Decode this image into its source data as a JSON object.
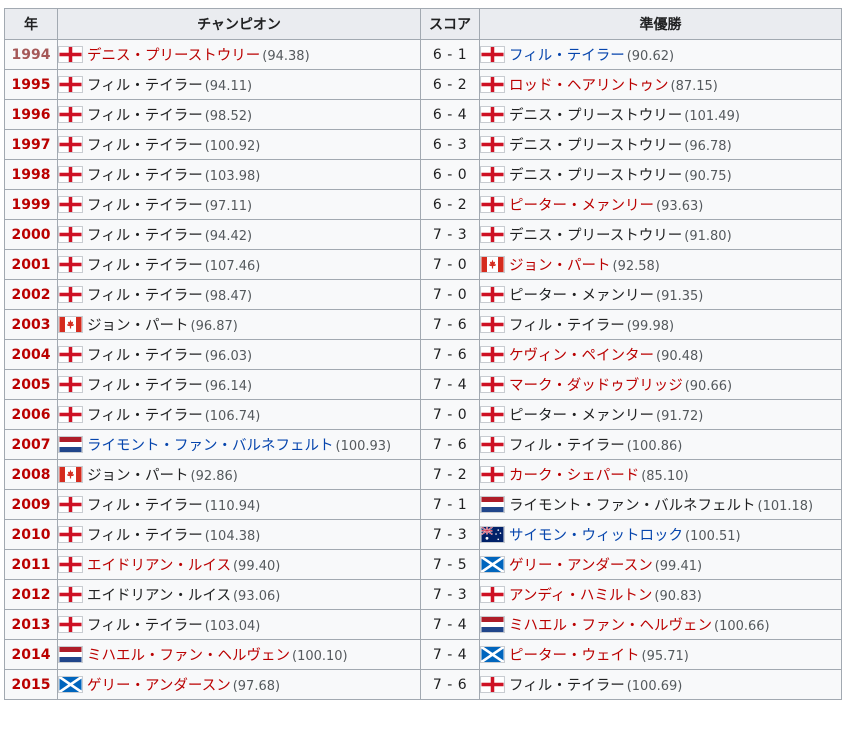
{
  "headers": {
    "year": "年",
    "champion": "チャンピオン",
    "score": "スコア",
    "runner_up": "準優勝"
  },
  "colors": {
    "link": "#0645ad",
    "redlink": "#ba0000",
    "header_bg": "#eaecf0",
    "border": "#a2a9b1"
  },
  "rows": [
    {
      "year": "1994",
      "year_style": "visited",
      "champion": {
        "flag": "england",
        "name": "デニス・プリーストウリー",
        "style": "redlink",
        "avg": "(94.38)"
      },
      "score": "6 - 1",
      "runner_up": {
        "flag": "england",
        "name": "フィル・テイラー",
        "style": "link",
        "avg": "(90.62)"
      }
    },
    {
      "year": "1995",
      "year_style": "redlink",
      "champion": {
        "flag": "england",
        "name": "フィル・テイラー",
        "style": "plain",
        "avg": "(94.11)"
      },
      "score": "6 - 2",
      "runner_up": {
        "flag": "england",
        "name": "ロッド・ヘアリントゥン",
        "style": "redlink",
        "avg": "(87.15)"
      }
    },
    {
      "year": "1996",
      "year_style": "redlink",
      "champion": {
        "flag": "england",
        "name": "フィル・テイラー",
        "style": "plain",
        "avg": "(98.52)"
      },
      "score": "6 - 4",
      "runner_up": {
        "flag": "england",
        "name": "デニス・プリーストウリー",
        "style": "plain",
        "avg": "(101.49)"
      }
    },
    {
      "year": "1997",
      "year_style": "redlink",
      "champion": {
        "flag": "england",
        "name": "フィル・テイラー",
        "style": "plain",
        "avg": "(100.92)"
      },
      "score": "6 - 3",
      "runner_up": {
        "flag": "england",
        "name": "デニス・プリーストウリー",
        "style": "plain",
        "avg": "(96.78)"
      }
    },
    {
      "year": "1998",
      "year_style": "redlink",
      "champion": {
        "flag": "england",
        "name": "フィル・テイラー",
        "style": "plain",
        "avg": "(103.98)"
      },
      "score": "6 - 0",
      "runner_up": {
        "flag": "england",
        "name": "デニス・プリーストウリー",
        "style": "plain",
        "avg": "(90.75)"
      }
    },
    {
      "year": "1999",
      "year_style": "redlink",
      "champion": {
        "flag": "england",
        "name": "フィル・テイラー",
        "style": "plain",
        "avg": "(97.11)"
      },
      "score": "6 - 2",
      "runner_up": {
        "flag": "england",
        "name": "ピーター・メァンリー",
        "style": "redlink",
        "avg": "(93.63)"
      }
    },
    {
      "year": "2000",
      "year_style": "redlink",
      "champion": {
        "flag": "england",
        "name": "フィル・テイラー",
        "style": "plain",
        "avg": "(94.42)"
      },
      "score": "7 - 3",
      "runner_up": {
        "flag": "england",
        "name": "デニス・プリーストウリー",
        "style": "plain",
        "avg": "(91.80)"
      }
    },
    {
      "year": "2001",
      "year_style": "redlink",
      "champion": {
        "flag": "england",
        "name": "フィル・テイラー",
        "style": "plain",
        "avg": "(107.46)"
      },
      "score": "7 - 0",
      "runner_up": {
        "flag": "canada",
        "name": "ジョン・パート",
        "style": "redlink",
        "avg": "(92.58)"
      }
    },
    {
      "year": "2002",
      "year_style": "redlink",
      "champion": {
        "flag": "england",
        "name": "フィル・テイラー",
        "style": "plain",
        "avg": "(98.47)"
      },
      "score": "7 - 0",
      "runner_up": {
        "flag": "england",
        "name": "ピーター・メァンリー",
        "style": "plain",
        "avg": "(91.35)"
      }
    },
    {
      "year": "2003",
      "year_style": "redlink",
      "champion": {
        "flag": "canada",
        "name": "ジョン・パート",
        "style": "plain",
        "avg": "(96.87)"
      },
      "score": "7 - 6",
      "runner_up": {
        "flag": "england",
        "name": "フィル・テイラー",
        "style": "plain",
        "avg": "(99.98)"
      }
    },
    {
      "year": "2004",
      "year_style": "redlink",
      "champion": {
        "flag": "england",
        "name": "フィル・テイラー",
        "style": "plain",
        "avg": "(96.03)"
      },
      "score": "7 - 6",
      "runner_up": {
        "flag": "england",
        "name": "ケヴィン・ペインター",
        "style": "redlink",
        "avg": "(90.48)"
      }
    },
    {
      "year": "2005",
      "year_style": "redlink",
      "champion": {
        "flag": "england",
        "name": "フィル・テイラー",
        "style": "plain",
        "avg": "(96.14)"
      },
      "score": "7 - 4",
      "runner_up": {
        "flag": "england",
        "name": "マーク・ダッドゥブリッジ",
        "style": "redlink",
        "avg": "(90.66)"
      }
    },
    {
      "year": "2006",
      "year_style": "redlink",
      "champion": {
        "flag": "england",
        "name": "フィル・テイラー",
        "style": "plain",
        "avg": "(106.74)"
      },
      "score": "7 - 0",
      "runner_up": {
        "flag": "england",
        "name": "ピーター・メァンリー",
        "style": "plain",
        "avg": "(91.72)"
      }
    },
    {
      "year": "2007",
      "year_style": "redlink",
      "champion": {
        "flag": "netherlands",
        "name": "ライモント・ファン・バルネフェルト",
        "style": "link",
        "avg": "(100.93)"
      },
      "score": "7 - 6",
      "runner_up": {
        "flag": "england",
        "name": "フィル・テイラー",
        "style": "plain",
        "avg": "(100.86)"
      }
    },
    {
      "year": "2008",
      "year_style": "redlink",
      "champion": {
        "flag": "canada",
        "name": "ジョン・パート",
        "style": "plain",
        "avg": "(92.86)"
      },
      "score": "7 - 2",
      "runner_up": {
        "flag": "england",
        "name": "カーク・シェパード",
        "style": "redlink",
        "avg": "(85.10)"
      }
    },
    {
      "year": "2009",
      "year_style": "redlink",
      "champion": {
        "flag": "england",
        "name": "フィル・テイラー",
        "style": "plain",
        "avg": "(110.94)"
      },
      "score": "7 - 1",
      "runner_up": {
        "flag": "netherlands",
        "name": "ライモント・ファン・バルネフェルト",
        "style": "plain",
        "avg": "(101.18)"
      }
    },
    {
      "year": "2010",
      "year_style": "redlink",
      "champion": {
        "flag": "england",
        "name": "フィル・テイラー",
        "style": "plain",
        "avg": "(104.38)"
      },
      "score": "7 - 3",
      "runner_up": {
        "flag": "australia",
        "name": "サイモン・ウィットロック",
        "style": "link",
        "avg": "(100.51)"
      }
    },
    {
      "year": "2011",
      "year_style": "redlink",
      "champion": {
        "flag": "england",
        "name": "エイドリアン・ルイス",
        "style": "redlink",
        "avg": "(99.40)"
      },
      "score": "7 - 5",
      "runner_up": {
        "flag": "scotland",
        "name": "ゲリー・アンダースン",
        "style": "redlink",
        "avg": "(99.41)"
      }
    },
    {
      "year": "2012",
      "year_style": "redlink",
      "champion": {
        "flag": "england",
        "name": "エイドリアン・ルイス",
        "style": "plain",
        "avg": "(93.06)"
      },
      "score": "7 - 3",
      "runner_up": {
        "flag": "england",
        "name": "アンディ・ハミルトン",
        "style": "redlink",
        "avg": "(90.83)"
      }
    },
    {
      "year": "2013",
      "year_style": "redlink",
      "champion": {
        "flag": "england",
        "name": "フィル・テイラー",
        "style": "plain",
        "avg": "(103.04)"
      },
      "score": "7 - 4",
      "runner_up": {
        "flag": "netherlands",
        "name": "ミハエル・ファン・ヘルヴェン",
        "style": "redlink",
        "avg": "(100.66)"
      }
    },
    {
      "year": "2014",
      "year_style": "redlink",
      "champion": {
        "flag": "netherlands",
        "name": "ミハエル・ファン・ヘルヴェン",
        "style": "redlink",
        "avg": "(100.10)"
      },
      "score": "7 - 4",
      "runner_up": {
        "flag": "scotland",
        "name": "ピーター・ウェイト",
        "style": "redlink",
        "avg": "(95.71)"
      }
    },
    {
      "year": "2015",
      "year_style": "redlink",
      "champion": {
        "flag": "scotland",
        "name": "ゲリー・アンダースン",
        "style": "redlink",
        "avg": "(97.68)"
      },
      "score": "7 - 6",
      "runner_up": {
        "flag": "england",
        "name": "フィル・テイラー",
        "style": "plain",
        "avg": "(100.69)"
      }
    }
  ]
}
